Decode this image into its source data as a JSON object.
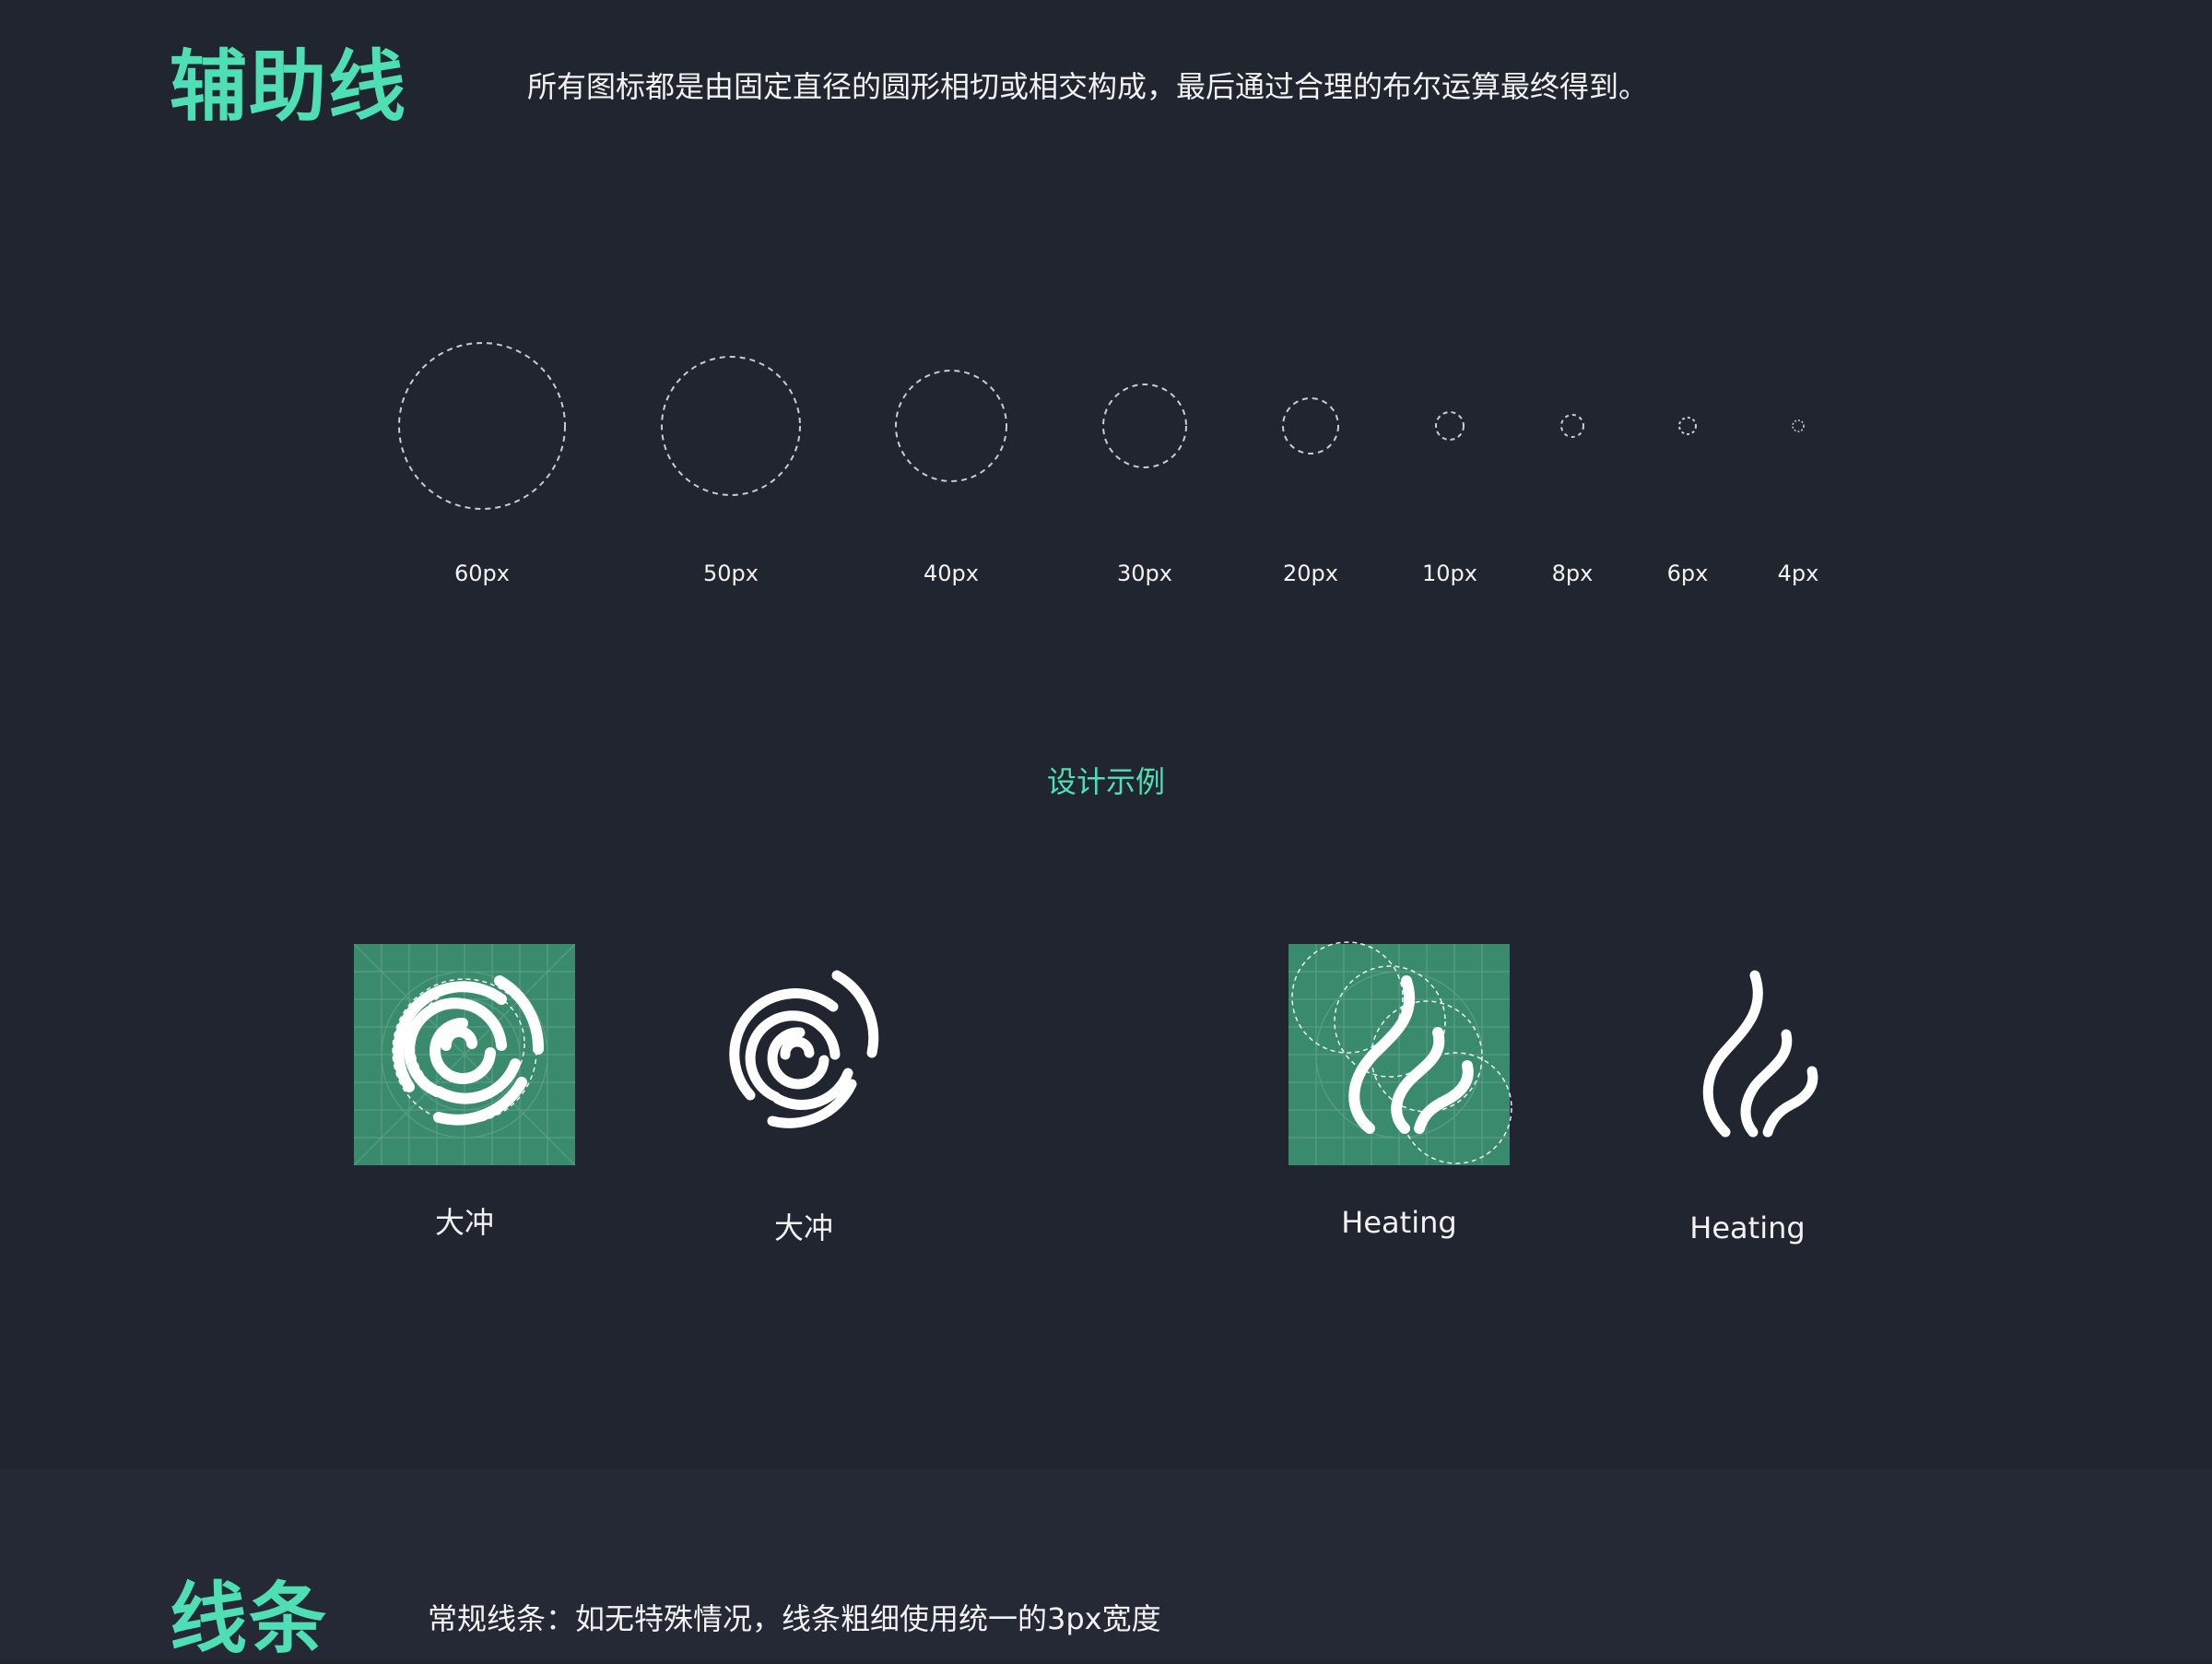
{
  "guides_section": {
    "title": "辅助线",
    "description": "所有图标都是由固定直径的圆形相切或相交构成，最后通过合理的布尔运算最终得到。"
  },
  "circle_sizes": [
    {
      "label": "60px"
    },
    {
      "label": "50px"
    },
    {
      "label": "40px"
    },
    {
      "label": "30px"
    },
    {
      "label": "20px"
    },
    {
      "label": "10px"
    },
    {
      "label": "8px"
    },
    {
      "label": "6px"
    },
    {
      "label": "4px"
    }
  ],
  "example": {
    "title": "设计示例",
    "icons": [
      {
        "label": "大冲",
        "icon": "spiral-icon",
        "variant": "guide"
      },
      {
        "label": "大冲",
        "icon": "spiral-icon",
        "variant": "plain"
      },
      {
        "label": "Heating",
        "icon": "heating-icon",
        "variant": "guide"
      },
      {
        "label": "Heating",
        "icon": "heating-icon",
        "variant": "plain"
      }
    ]
  },
  "lines_section": {
    "title": "线条",
    "description": "常规线条：如无特殊情况，线条粗细使用统一的3px宽度"
  },
  "colors": {
    "background": "#21252f",
    "accent": "#4ee0b4",
    "icon_card": "#3a8a6e",
    "text": "#f2f2f2"
  }
}
